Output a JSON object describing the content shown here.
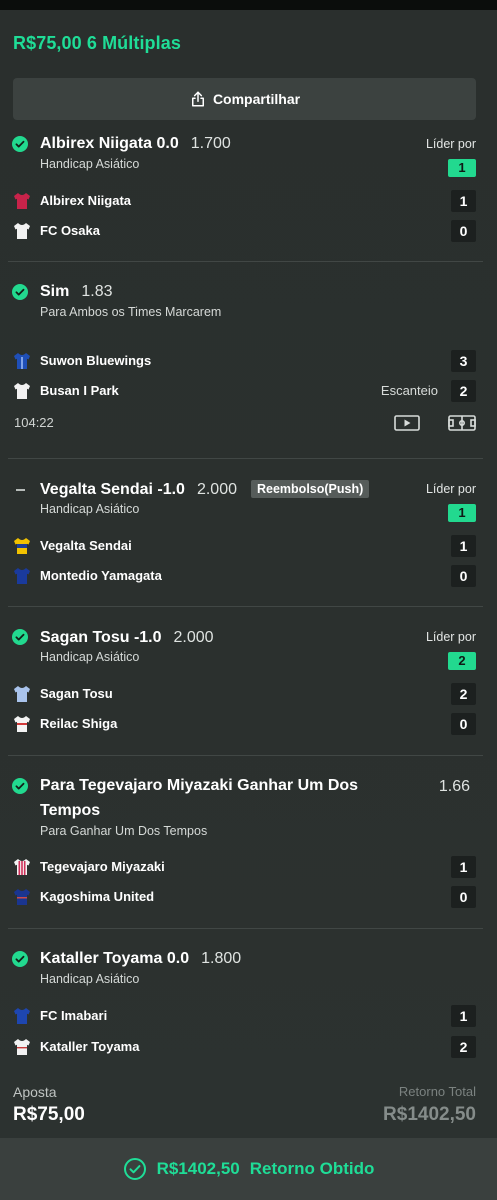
{
  "header": {
    "title": "R$75,00 6 Múltiplas",
    "share_label": "Compartilhar"
  },
  "colors": {
    "accent": "#1fdd97",
    "lider_badge": "#22d98f",
    "background": "#2b302e"
  },
  "bets": [
    {
      "status": "won",
      "selection": "Albirex Niigata 0.0",
      "odds": "1.700",
      "market": "Handicap Asiático",
      "lider_label": "Líder por",
      "lider_value": "1",
      "teams": [
        {
          "name": "Albirex Niigata",
          "score": "1",
          "jersey": "red-jersey-icon"
        },
        {
          "name": "FC Osaka",
          "score": "0",
          "jersey": "white-jersey-icon"
        }
      ]
    },
    {
      "status": "won",
      "selection": "Sim",
      "odds": "1.83",
      "market": "Para Ambos os Times Marcarem",
      "teams": [
        {
          "name": "Suwon Bluewings",
          "score": "3",
          "jersey": "blue-jersey-icon"
        },
        {
          "name": "Busan I Park",
          "score": "2",
          "jersey": "white-jersey-icon",
          "extra": "Escanteio"
        }
      ],
      "clock": "104:22"
    },
    {
      "status": "push",
      "selection": "Vegalta Sendai -1.0",
      "odds": "2.000",
      "badge": "Reembolso(Push)",
      "market": "Handicap Asiático",
      "lider_label": "Líder por",
      "lider_value": "1",
      "teams": [
        {
          "name": "Vegalta Sendai",
          "score": "1",
          "jersey": "yellow-blue-jersey-icon"
        },
        {
          "name": "Montedio Yamagata",
          "score": "0",
          "jersey": "navy-jersey-icon"
        }
      ]
    },
    {
      "status": "won",
      "selection": "Sagan Tosu -1.0",
      "odds": "2.000",
      "market": "Handicap Asiático",
      "lider_label": "Líder por",
      "lider_value": "2",
      "teams": [
        {
          "name": "Sagan Tosu",
          "score": "2",
          "jersey": "light-blue-jersey-icon"
        },
        {
          "name": "Reilac Shiga",
          "score": "0",
          "jersey": "white-red-jersey-icon"
        }
      ]
    },
    {
      "status": "won",
      "selection_line1": "Para Tegevajaro Miyazaki Ganhar Um Dos",
      "selection_line2": "Tempos",
      "odds": "1.66",
      "market": "Para Ganhar Um Dos Tempos",
      "teams": [
        {
          "name": "Tegevajaro Miyazaki",
          "score": "1",
          "jersey": "striped-jersey-icon"
        },
        {
          "name": "Kagoshima United",
          "score": "0",
          "jersey": "navy-jersey-icon"
        }
      ]
    },
    {
      "status": "won",
      "selection": "Kataller Toyama 0.0",
      "odds": "1.800",
      "market": "Handicap Asiático",
      "teams": [
        {
          "name": "FC Imabari",
          "score": "1",
          "jersey": "blue-jersey-icon"
        },
        {
          "name": "Kataller Toyama",
          "score": "2",
          "jersey": "white-jersey-icon"
        }
      ]
    }
  ],
  "summary": {
    "stake_label": "Aposta",
    "stake_value": "R$75,00",
    "return_label": "Retorno Total",
    "return_value": "R$1402,50"
  },
  "footer": {
    "amount": "R$1402,50",
    "label": "Retorno Obtido"
  }
}
